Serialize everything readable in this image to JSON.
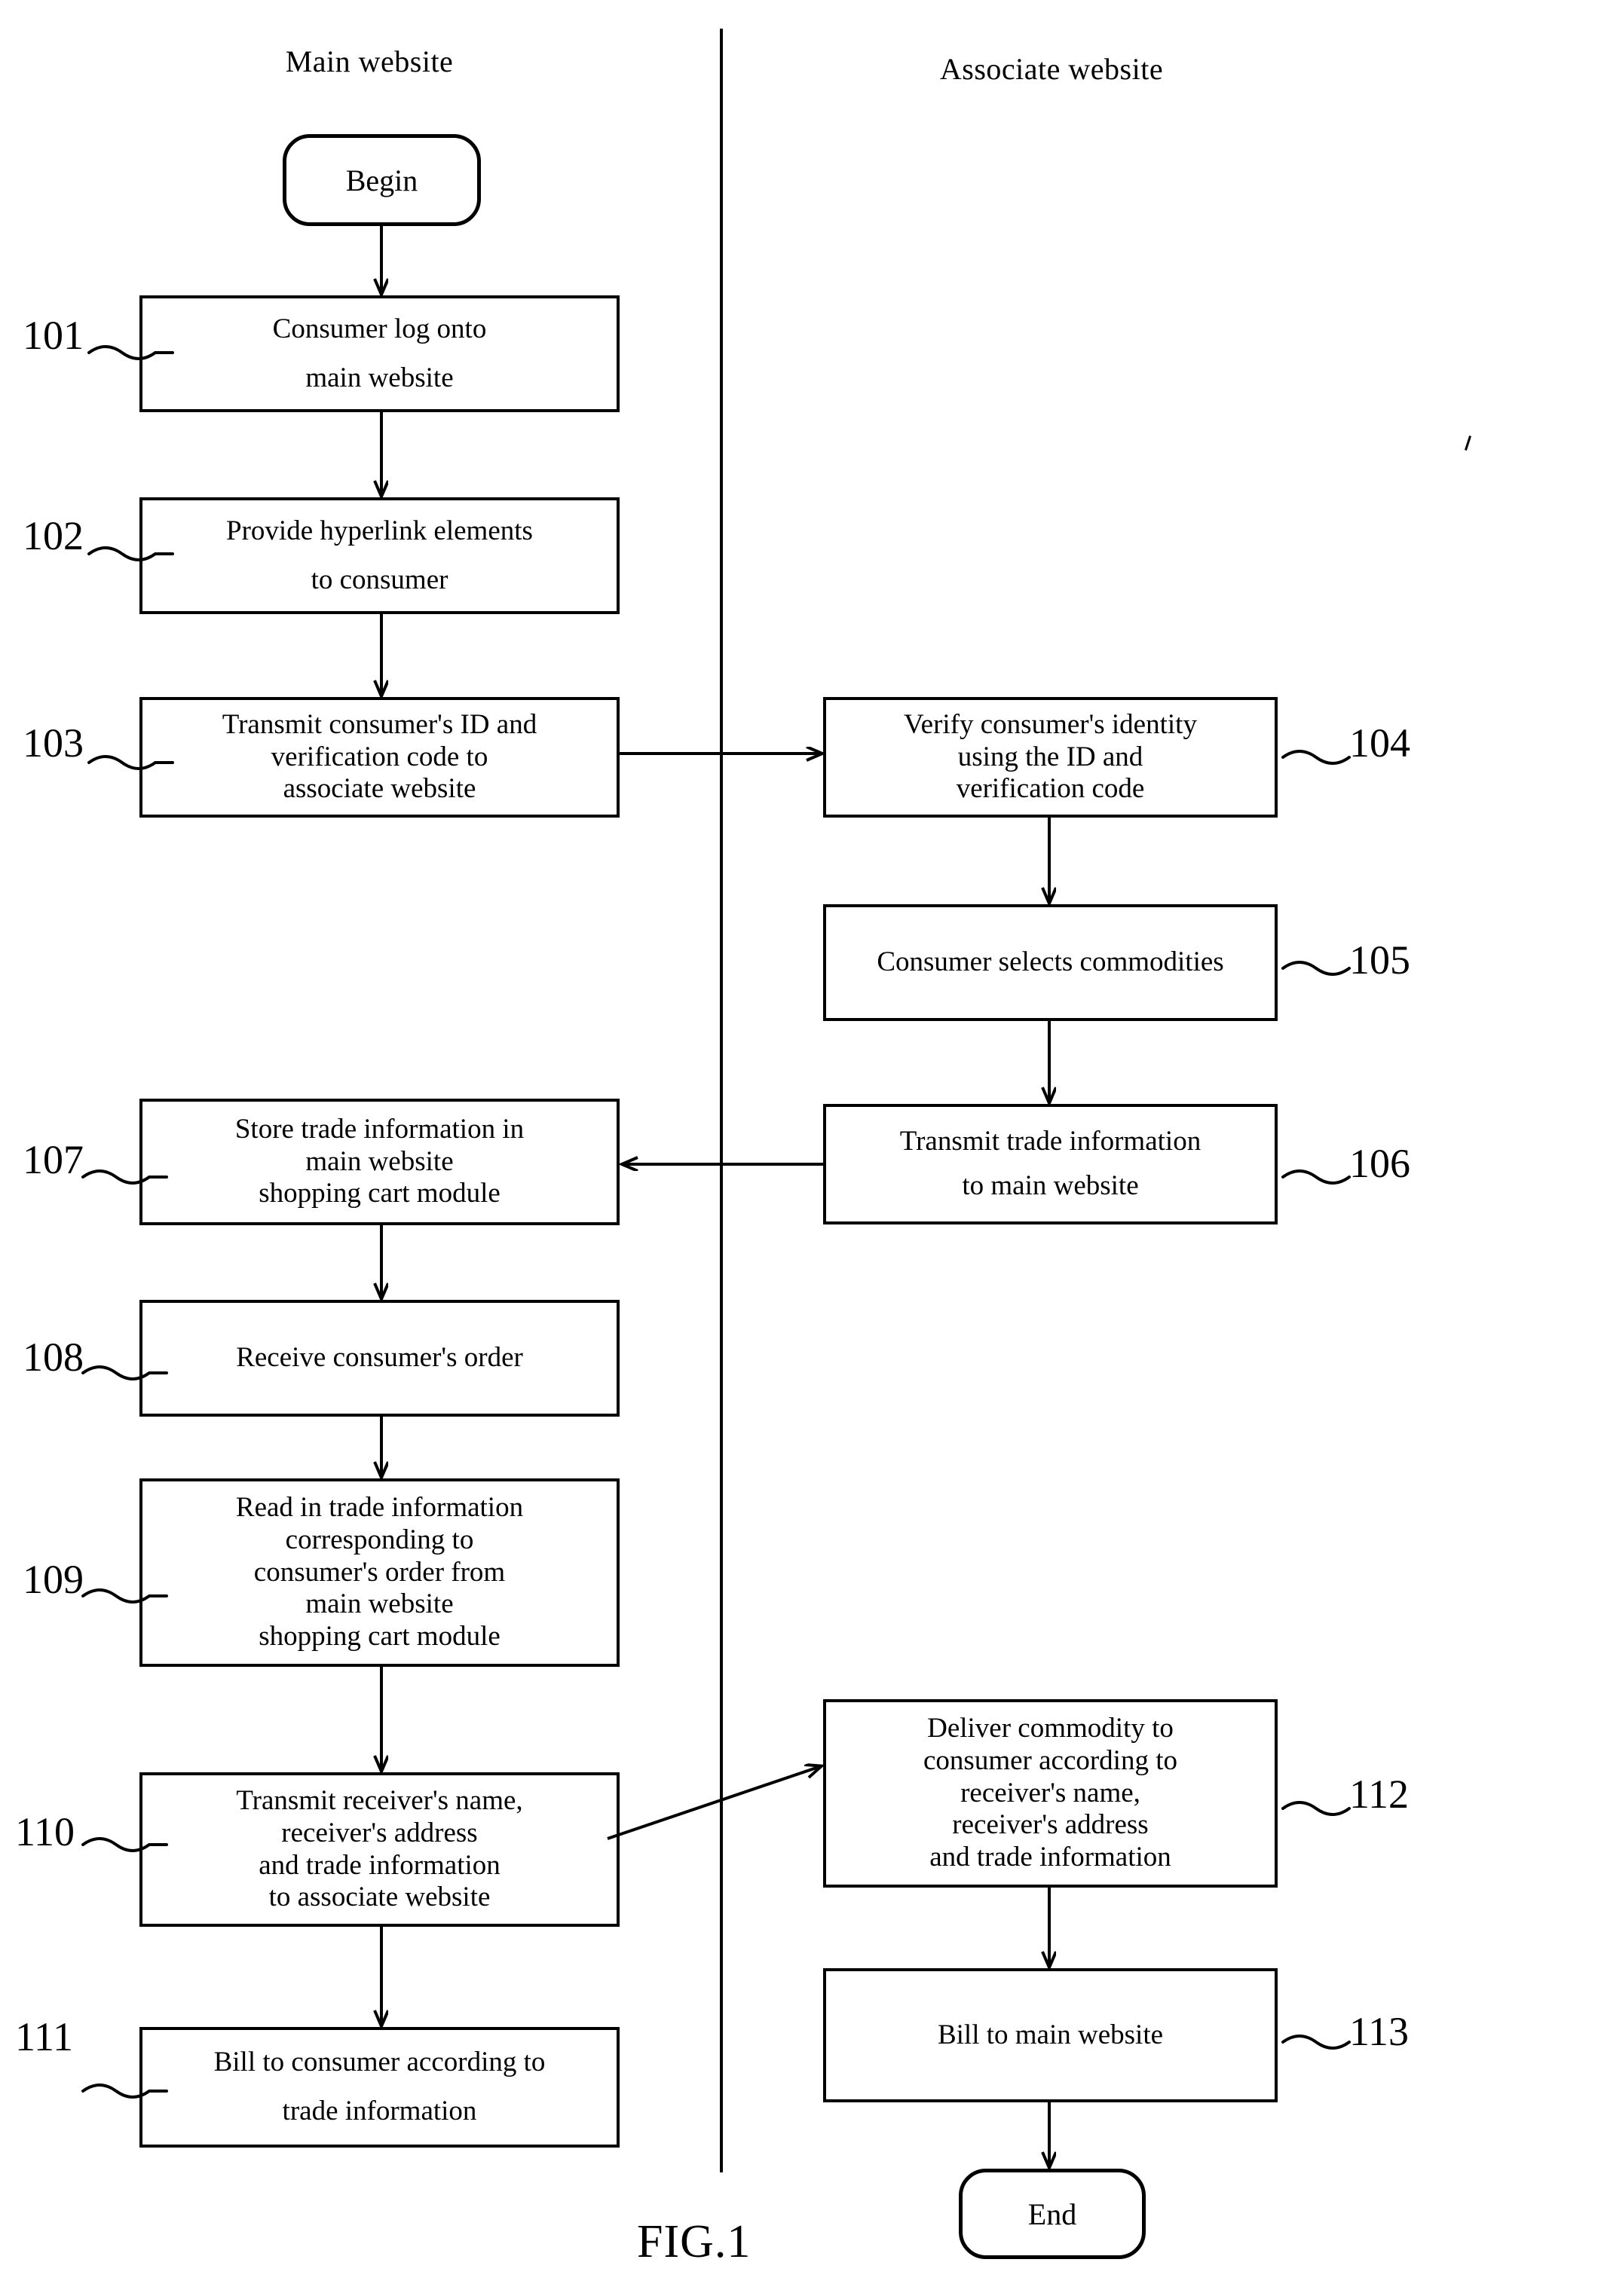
{
  "figure": {
    "caption": "FIG.1",
    "columns": [
      {
        "id": "main",
        "title": "Main website"
      },
      {
        "id": "associate",
        "title": "Associate website"
      }
    ]
  },
  "terminators": {
    "begin": {
      "label": "Begin"
    },
    "end": {
      "label": "End"
    }
  },
  "steps": [
    {
      "ref": "101",
      "column": "main",
      "lines": [
        "Consumer log onto",
        "main website"
      ],
      "text": "Consumer log onto main website"
    },
    {
      "ref": "102",
      "column": "main",
      "lines": [
        "Provide hyperlink elements",
        "to consumer"
      ],
      "text": "Provide hyperlink elements to consumer"
    },
    {
      "ref": "103",
      "column": "main",
      "lines": [
        "Transmit consumer's ID and",
        "verification code to",
        "associate website"
      ],
      "text": "Transmit consumer's ID and verification code to associate website"
    },
    {
      "ref": "104",
      "column": "associate",
      "lines": [
        "Verify consumer's identity",
        "using the ID and",
        "verification code"
      ],
      "text": "Verify consumer's identity using the ID and verification code"
    },
    {
      "ref": "105",
      "column": "associate",
      "lines": [
        "Consumer selects commodities"
      ],
      "text": "Consumer selects commodities"
    },
    {
      "ref": "106",
      "column": "associate",
      "lines": [
        "Transmit trade information",
        "to main website"
      ],
      "text": "Transmit trade information to main website"
    },
    {
      "ref": "107",
      "column": "main",
      "lines": [
        "Store trade information in",
        "main website",
        "shopping cart module"
      ],
      "text": "Store trade information in main website shopping cart module"
    },
    {
      "ref": "108",
      "column": "main",
      "lines": [
        "Receive consumer's order"
      ],
      "text": "Receive consumer's order"
    },
    {
      "ref": "109",
      "column": "main",
      "lines": [
        "Read in trade information",
        "corresponding to",
        "consumer's order from",
        "main website",
        "shopping cart module"
      ],
      "text": "Read in trade information corresponding to consumer's order from main website shopping cart module"
    },
    {
      "ref": "110",
      "column": "main",
      "lines": [
        "Transmit receiver's name,",
        "receiver's address",
        "and trade information",
        "to associate website"
      ],
      "text": "Transmit receiver's name, receiver's address and trade information to associate website"
    },
    {
      "ref": "111",
      "column": "main",
      "lines": [
        "Bill to consumer according to",
        "trade information"
      ],
      "text": "Bill to consumer according to trade information"
    },
    {
      "ref": "112",
      "column": "associate",
      "lines": [
        "Deliver commodity to",
        "consumer according to",
        "receiver's name,",
        "receiver's address",
        "and trade information"
      ],
      "text": "Deliver commodity to consumer according to receiver's name, receiver's address and trade information"
    },
    {
      "ref": "113",
      "column": "associate",
      "lines": [
        "Bill to main website"
      ],
      "text": "Bill to main website"
    }
  ],
  "connectors": [
    {
      "from": "begin",
      "to": "101",
      "kind": "vertical-arrow"
    },
    {
      "from": "101",
      "to": "102",
      "kind": "vertical-arrow"
    },
    {
      "from": "102",
      "to": "103",
      "kind": "vertical-arrow"
    },
    {
      "from": "103",
      "to": "104",
      "kind": "horizontal-arrow-right"
    },
    {
      "from": "104",
      "to": "105",
      "kind": "vertical-arrow"
    },
    {
      "from": "105",
      "to": "106",
      "kind": "vertical-arrow"
    },
    {
      "from": "106",
      "to": "107",
      "kind": "horizontal-arrow-left"
    },
    {
      "from": "107",
      "to": "108",
      "kind": "vertical-arrow"
    },
    {
      "from": "108",
      "to": "109",
      "kind": "vertical-arrow"
    },
    {
      "from": "109",
      "to": "110",
      "kind": "vertical-arrow"
    },
    {
      "from": "110",
      "to": "111",
      "kind": "vertical-arrow"
    },
    {
      "from": "110",
      "to": "112",
      "kind": "diagonal-arrow-up-right"
    },
    {
      "from": "112",
      "to": "113",
      "kind": "vertical-arrow"
    },
    {
      "from": "113",
      "to": "end",
      "kind": "vertical-arrow"
    }
  ],
  "colors": {
    "ink": "#000000",
    "paper": "#ffffff"
  }
}
